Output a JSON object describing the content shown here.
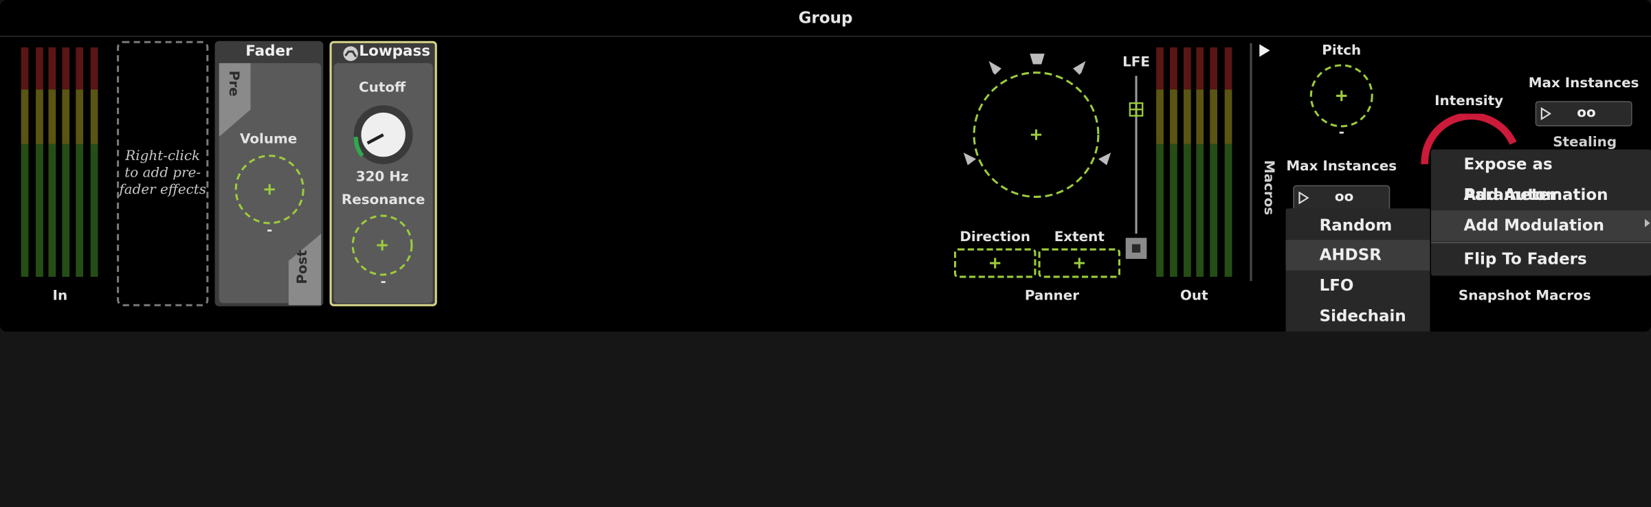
{
  "window": {
    "title": "Group"
  },
  "input": {
    "label": "In"
  },
  "pre_fader": {
    "hint": "Right-click to add pre-fader effects"
  },
  "fader": {
    "title": "Fader",
    "pre_label": "Pre",
    "post_label": "Post",
    "volume_label": "Volume",
    "volume_value": "-"
  },
  "lowpass": {
    "title": "Lowpass",
    "cutoff_label": "Cutoff",
    "cutoff_value": "320 Hz",
    "resonance_label": "Resonance",
    "resonance_value": "-"
  },
  "panner": {
    "title": "Panner",
    "lfe_label": "LFE",
    "direction_label": "Direction",
    "extent_label": "Extent"
  },
  "output": {
    "label": "Out"
  },
  "macros": {
    "tab_label": "Macros",
    "pitch_label": "Pitch",
    "pitch_value": "-",
    "intensity_label": "Intensity",
    "max_instances_label": "Max Instances",
    "max_instances_value": "oo",
    "max_instances_label_2": "Max Instances",
    "max_instances_value_2": "oo",
    "stealing_label": "Stealing",
    "snapshot_label": "Snapshot Macros"
  },
  "context_menu": {
    "items": [
      "Expose as Parameter",
      "Add Automation",
      "Add Modulation",
      "Flip To Faders"
    ]
  },
  "modulation_submenu": {
    "items": [
      "Random",
      "AHDSR",
      "LFO",
      "Sidechain"
    ]
  },
  "colors": {
    "accent_green": "#9ccc3c",
    "lowpass_border": "#d9d68a",
    "intensity_ring": "#cc1a3a"
  }
}
